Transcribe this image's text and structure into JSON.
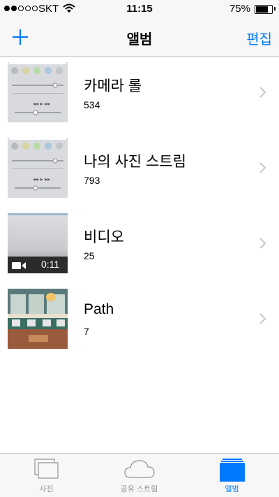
{
  "status_bar": {
    "carrier": "SKT",
    "time": "11:15",
    "battery": "75%",
    "signal_bars": 2,
    "signal_total": 5
  },
  "nav": {
    "title": "앨범",
    "edit_label": "편집",
    "add_icon": "plus-icon"
  },
  "albums": [
    {
      "title": "카메라 롤",
      "count": "534",
      "thumb": "control-center"
    },
    {
      "title": "나의 사진 스트림",
      "count": "793",
      "thumb": "control-center"
    },
    {
      "title": "비디오",
      "count": "25",
      "thumb": "video",
      "duration": "0:11"
    },
    {
      "title": "Path",
      "count": "7",
      "thumb": "cafe"
    }
  ],
  "tabs": [
    {
      "label": "사진",
      "icon": "photos-icon",
      "active": false
    },
    {
      "label": "공유 스트림",
      "icon": "cloud-icon",
      "active": false
    },
    {
      "label": "앨범",
      "icon": "albums-icon",
      "active": true
    }
  ],
  "colors": {
    "accent": "#007aff",
    "inactive": "#929292",
    "bar_bg": "#f7f7f7",
    "separator": "#c7c7cc"
  }
}
